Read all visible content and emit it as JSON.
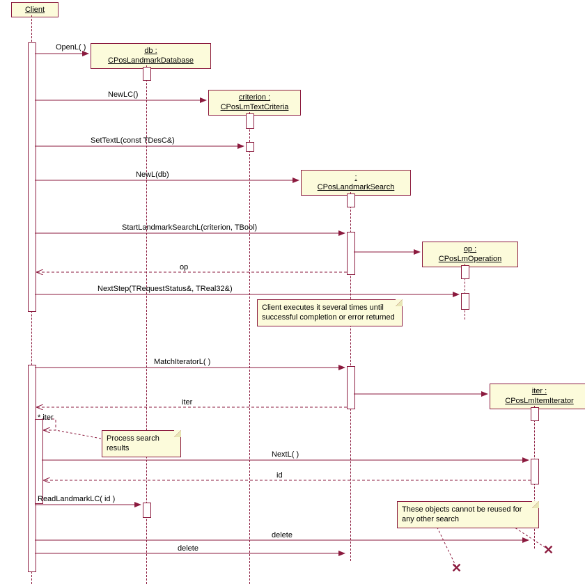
{
  "participants": {
    "client": {
      "name": "Client"
    },
    "db": {
      "name": "db :",
      "type": "CPosLandmarkDatabase"
    },
    "criterion": {
      "name": "criterion :",
      "type": "CPosLmTextCriteria"
    },
    "search": {
      "name": ":",
      "type": "CPosLandmarkSearch"
    },
    "op": {
      "name": "op :",
      "type": "CPosLmOperation"
    },
    "iter": {
      "name": "iter :",
      "type": "CPosLmItemIterator"
    }
  },
  "messages": {
    "openL": "OpenL( )",
    "newLC": "NewLC()",
    "setTextL": "SetTextL(const TDesC&)",
    "newLdb": "NewL(db)",
    "startSearch": "StartLandmarkSearchL(criterion, TBool)",
    "opReturn": "op",
    "nextStep": "NextStep(TRequestStatus&, TReal32&)",
    "matchIterator": "MatchIteratorL( )",
    "iterReturn": "iter",
    "iterLoop": "* iter",
    "nextL": "NextL( )",
    "idReturn": "id",
    "readLandmark": "ReadLandmarkLC( id )",
    "delete1": "delete",
    "delete2": "delete"
  },
  "notes": {
    "nextStepNote": "Client executes it several times until successful completion or error returned",
    "processNote": "Process search results",
    "reuseNote": "These objects cannot be reused for any other search"
  },
  "chart_data": {
    "type": "sequence-diagram",
    "participants": [
      "Client",
      "db : CPosLandmarkDatabase",
      "criterion : CPosLmTextCriteria",
      ": CPosLandmarkSearch",
      "op : CPosLmOperation",
      "iter : CPosLmItemIterator"
    ],
    "interactions": [
      {
        "from": "Client",
        "to": "db",
        "label": "OpenL( )",
        "type": "create"
      },
      {
        "from": "Client",
        "to": "criterion",
        "label": "NewLC()",
        "type": "create"
      },
      {
        "from": "Client",
        "to": "criterion",
        "label": "SetTextL(const TDesC&)",
        "type": "call"
      },
      {
        "from": "Client",
        "to": "search",
        "label": "NewL(db)",
        "type": "create"
      },
      {
        "from": "Client",
        "to": "search",
        "label": "StartLandmarkSearchL(criterion, TBool)",
        "type": "call"
      },
      {
        "from": "search",
        "to": "op",
        "label": "",
        "type": "create"
      },
      {
        "from": "search",
        "to": "Client",
        "label": "op",
        "type": "return"
      },
      {
        "from": "Client",
        "to": "op",
        "label": "NextStep(TRequestStatus&, TReal32&)",
        "type": "call",
        "note": "Client executes it several times until successful completion or error returned"
      },
      {
        "from": "Client",
        "to": "search",
        "label": "MatchIteratorL( )",
        "type": "call"
      },
      {
        "from": "search",
        "to": "iter",
        "label": "",
        "type": "create"
      },
      {
        "from": "search",
        "to": "Client",
        "label": "iter",
        "type": "return"
      },
      {
        "from": "Client",
        "to": "Client",
        "label": "* iter",
        "type": "self",
        "note": "Process search results"
      },
      {
        "from": "Client",
        "to": "iter",
        "label": "NextL( )",
        "type": "call"
      },
      {
        "from": "iter",
        "to": "Client",
        "label": "id",
        "type": "return"
      },
      {
        "from": "Client",
        "to": "db",
        "label": "ReadLandmarkLC( id )",
        "type": "call"
      },
      {
        "from": "Client",
        "to": "iter",
        "label": "delete",
        "type": "destroy",
        "note": "These objects cannot be reused for any other search"
      },
      {
        "from": "Client",
        "to": "search",
        "label": "delete",
        "type": "destroy"
      }
    ]
  }
}
